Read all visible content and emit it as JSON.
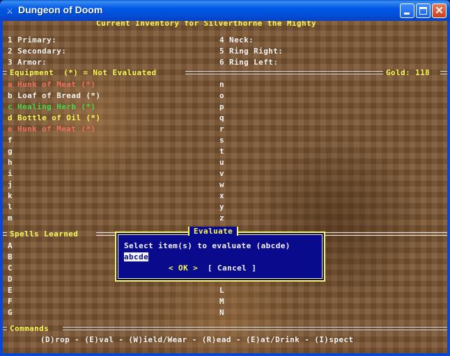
{
  "window": {
    "title": "Dungeon of Doom",
    "icon": "sword-icon"
  },
  "header": "Current Inventory for Silverthorne the Mighty",
  "slots": {
    "left": [
      "1 Primary:",
      "2 Secondary:",
      "3 Armor:"
    ],
    "right": [
      "4 Neck:",
      "5 Ring Right:",
      "6 Ring Left:"
    ]
  },
  "equipment": {
    "label": "Equipment  (*) = Not Evaluated",
    "gold": "Gold: 118",
    "left_items": [
      {
        "text": "a Hunk of Meat (*)",
        "color": "#f07060"
      },
      {
        "text": "b Loaf of Bread (*)",
        "color": "#f4f4f4"
      },
      {
        "text": "c Healing Herb (*)",
        "color": "#48d848"
      },
      {
        "text": "d Bottle of Oil (*)",
        "color": "#f8f85a"
      },
      {
        "text": "e Hunk of Meat (*)",
        "color": "#f07060"
      },
      {
        "text": "f",
        "color": "#f4f4f4"
      },
      {
        "text": "g",
        "color": "#f4f4f4"
      },
      {
        "text": "h",
        "color": "#f4f4f4"
      },
      {
        "text": "i",
        "color": "#f4f4f4"
      },
      {
        "text": "j",
        "color": "#f4f4f4"
      },
      {
        "text": "k",
        "color": "#f4f4f4"
      },
      {
        "text": "l",
        "color": "#f4f4f4"
      },
      {
        "text": "m",
        "color": "#f4f4f4"
      }
    ],
    "right_items": [
      "n",
      "o",
      "p",
      "q",
      "r",
      "s",
      "t",
      "u",
      "v",
      "w",
      "x",
      "y",
      "z"
    ]
  },
  "spells": {
    "label": "Spells Learned",
    "left": [
      "A",
      "B",
      "C",
      "D",
      "E",
      "F",
      "G"
    ],
    "right": [
      "L",
      "M",
      "N"
    ]
  },
  "commands": {
    "label": "Commands",
    "line": "(D)rop - (E)val - (W)ield/Wear - (R)ead - (E)at/Drink - (I)spect"
  },
  "dialog": {
    "title": "Evaluate",
    "prompt": "Select item(s) to evaluate (abcde)",
    "input_value": "abcde",
    "ok": "< OK >",
    "cancel": "[ Cancel ]"
  }
}
